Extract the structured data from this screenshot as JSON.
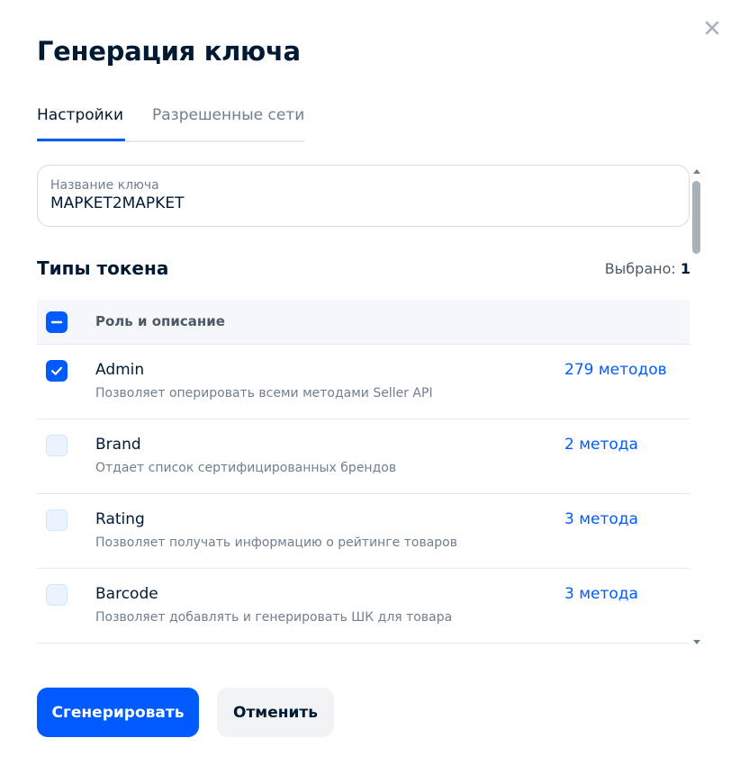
{
  "dialog": {
    "title": "Генерация ключа",
    "close_icon": "close-icon"
  },
  "tabs": [
    {
      "label": "Настройки",
      "active": true
    },
    {
      "label": "Разрешенные сети",
      "active": false
    }
  ],
  "key_name": {
    "label": "Название ключа",
    "value": "MAPKET2MAPKET"
  },
  "token_types": {
    "title": "Типы токена",
    "selected_label": "Выбрано:",
    "selected_count": "1",
    "header_label": "Роль и описание",
    "header_checkbox_state": "indeterminate",
    "rows": [
      {
        "name": "Admin",
        "description": "Позволяет оперировать всеми методами Seller API",
        "methods": "279 методов",
        "checked": true
      },
      {
        "name": "Brand",
        "description": "Отдает список сертифицированных брендов",
        "methods": "2 метода",
        "checked": false
      },
      {
        "name": "Rating",
        "description": "Позволяет получать информацию о рейтинге товаров",
        "methods": "3 метода",
        "checked": false
      },
      {
        "name": "Barcode",
        "description": "Позволяет добавлять и генерировать ШК для товара",
        "methods": "3 метода",
        "checked": false
      }
    ]
  },
  "buttons": {
    "generate": "Сгенерировать",
    "cancel": "Отменить"
  },
  "colors": {
    "accent": "#005bff",
    "text_primary": "#001a34",
    "text_secondary": "#707f8d"
  }
}
